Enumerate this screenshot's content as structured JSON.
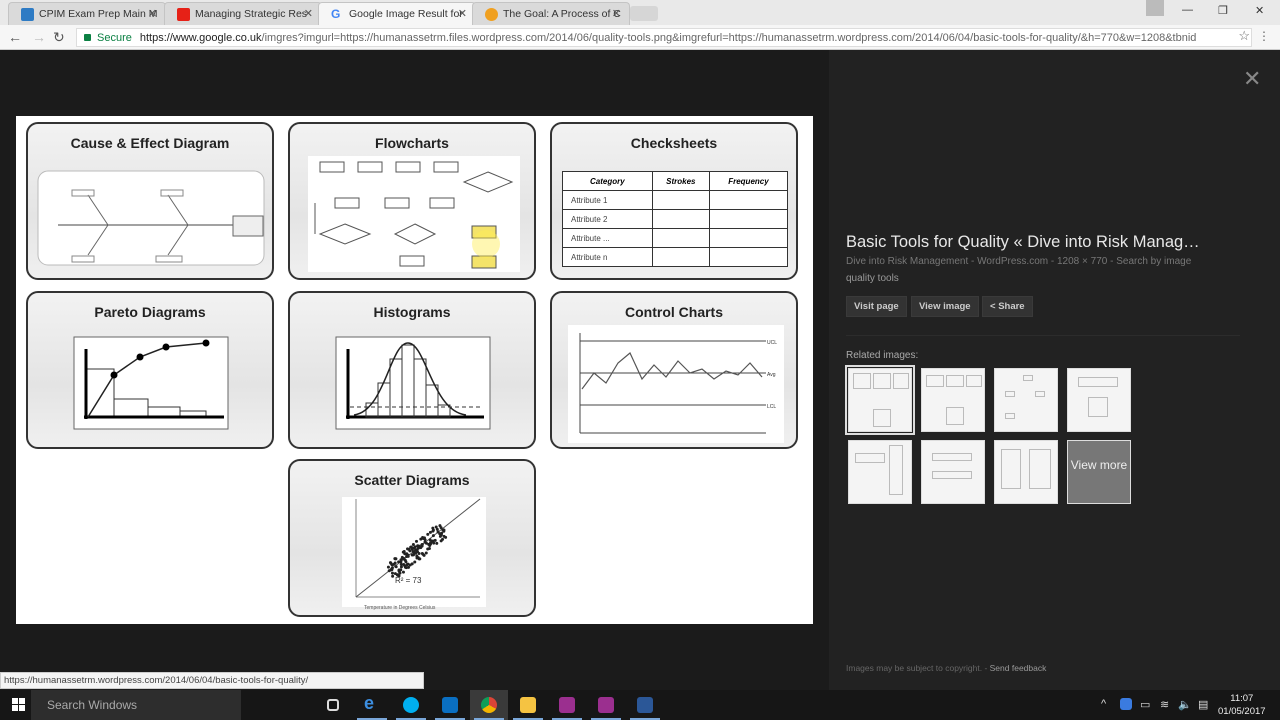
{
  "browser": {
    "tabs": [
      {
        "label": "CPIM Exam Prep Main M",
        "icon": "cpim-icon",
        "color": "#2e7bc4"
      },
      {
        "label": "Managing Strategic Res",
        "icon": "youtube-icon",
        "color": "#e62117"
      },
      {
        "label": "Google Image Result for",
        "icon": "google-icon",
        "color": "#4285f4",
        "active": true
      },
      {
        "label": "The Goal: A Process of C",
        "icon": "amazon-icon",
        "color": "#f0a020"
      }
    ],
    "secure_label": "Secure",
    "url_domain": "https://www.google.co.uk",
    "url_rest": "/imgres?imgurl=https://humanassetrm.files.wordpress.com/2014/06/quality-tools.png&imgrefurl=https://humanassetrm.wordpress.com/2014/06/04/basic-tools-for-quality/&h=770&w=1208&tbnid",
    "status_url": "https://humanassetrm.wordpress.com/2014/06/04/basic-tools-for-quality/"
  },
  "image": {
    "panels": [
      "Cause & Effect Diagram",
      "Flowcharts",
      "Checksheets",
      "Pareto Diagrams",
      "Histograms",
      "Control Charts",
      "Scatter Diagrams"
    ],
    "checksheet": {
      "headers": [
        "Category",
        "Strokes",
        "Frequency"
      ],
      "rows": [
        "Attribute 1",
        "Attribute 2",
        "Attribute ...",
        "Attribute n"
      ]
    },
    "control_labels": [
      "UCL",
      "Avg",
      "LCL"
    ],
    "scatter_r2": "R² = 73",
    "scatter_xlabel": "Temperature in Degrees Celsius"
  },
  "panel": {
    "title": "Basic Tools for Quality « Dive into Risk Manag…",
    "source": "Dive into Risk Management - WordPress.com",
    "dimensions": "1208 × 770",
    "search_by_image": "Search by image",
    "query": "quality tools",
    "visit_page": "Visit page",
    "view_image": "View image",
    "share": "Share",
    "related_label": "Related images:",
    "view_more": "View more",
    "copyright": "Images may be subject to copyright.",
    "feedback": "Send feedback"
  },
  "taskbar": {
    "search_placeholder": "Search Windows",
    "time": "11:07",
    "date": "01/05/2017"
  }
}
